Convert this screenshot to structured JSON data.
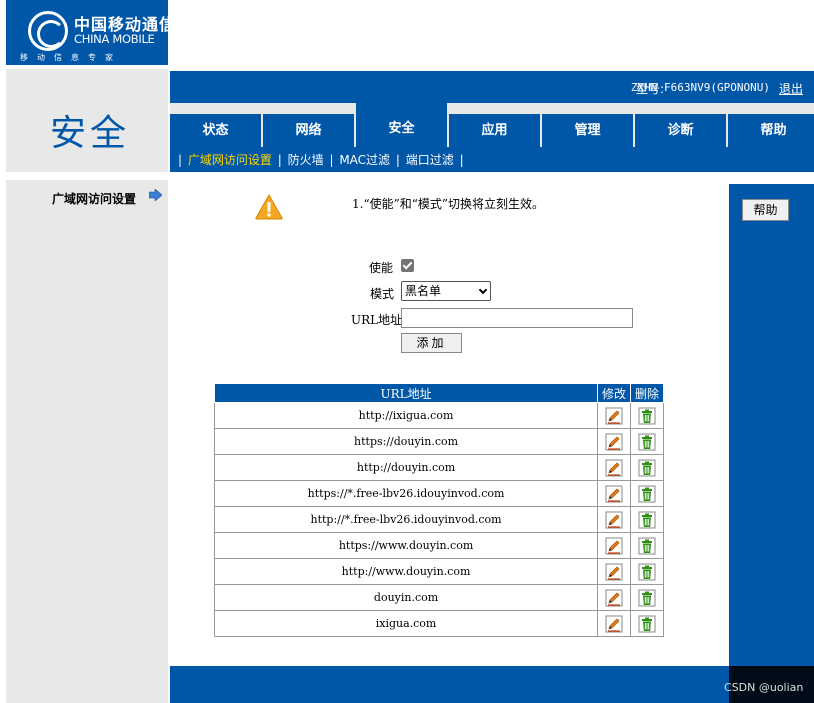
{
  "brand": {
    "name_cn": "中国移动通信",
    "name_en": "CHINA MOBILE",
    "slogan": "移动信息专家"
  },
  "header": {
    "section_title": "安全",
    "model_label": "型号:",
    "model_value": "ZXHN F663NV9(GPONONU)",
    "logout": "退出"
  },
  "tabs": [
    {
      "label": "状态",
      "active": false
    },
    {
      "label": "网络",
      "active": false
    },
    {
      "label": "安全",
      "active": true
    },
    {
      "label": "应用",
      "active": false
    },
    {
      "label": "管理",
      "active": false
    },
    {
      "label": "诊断",
      "active": false
    },
    {
      "label": "帮助",
      "active": false
    }
  ],
  "sub_nav": {
    "items": [
      "广域网访问设置",
      "防火墙",
      "MAC过滤",
      "端口过滤"
    ]
  },
  "left_menu": {
    "item": "广域网访问设置"
  },
  "notice": "1.“使能”和“模式”切换将立刻生效。",
  "form": {
    "enable_label": "使能",
    "enable_checked": true,
    "mode_label": "模式",
    "mode_value": "黑名单",
    "url_label": "URL地址",
    "url_value": "",
    "add_button": "添加"
  },
  "help_button": "帮助",
  "table": {
    "headers": {
      "url": "URL地址",
      "edit": "修改",
      "delete": "删除"
    },
    "rows": [
      "http://ixigua.com",
      "https://douyin.com",
      "http://douyin.com",
      "https://*.free-lbv26.idouyinvod.com",
      "http://*.free-lbv26.idouyinvod.com",
      "https://www.douyin.com",
      "http://www.douyin.com",
      "douyin.com",
      "ixigua.com"
    ]
  },
  "watermark": "CSDN @uolian",
  "colors": {
    "primary": "#0057a8",
    "panel": "#e8e8e8",
    "warning": "#f5a623",
    "edit_icon": "#e87b1c",
    "delete_icon": "#2f8f16"
  }
}
